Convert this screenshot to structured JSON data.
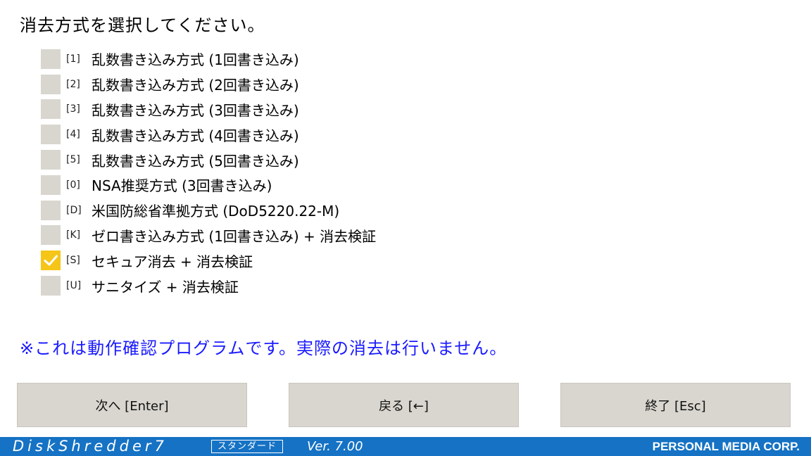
{
  "prompt": "消去方式を選択してください。",
  "options": [
    {
      "key": "[1]",
      "label": "乱数書き込み方式 (1回書き込み)",
      "checked": false
    },
    {
      "key": "[2]",
      "label": "乱数書き込み方式 (2回書き込み)",
      "checked": false
    },
    {
      "key": "[3]",
      "label": "乱数書き込み方式 (3回書き込み)",
      "checked": false
    },
    {
      "key": "[4]",
      "label": "乱数書き込み方式 (4回書き込み)",
      "checked": false
    },
    {
      "key": "[5]",
      "label": "乱数書き込み方式 (5回書き込み)",
      "checked": false
    },
    {
      "key": "[0]",
      "label": "NSA推奨方式 (3回書き込み)",
      "checked": false
    },
    {
      "key": "[D]",
      "label": "米国防総省準拠方式 (DoD5220.22-M)",
      "checked": false
    },
    {
      "key": "[K]",
      "label": "ゼロ書き込み方式 (1回書き込み) + 消去検証",
      "checked": false
    },
    {
      "key": "[S]",
      "label": "セキュア消去 + 消去検証",
      "checked": true
    },
    {
      "key": "[U]",
      "label": "サニタイズ + 消去検証",
      "checked": false
    }
  ],
  "notice": "※これは動作確認プログラムです。実際の消去は行いません。",
  "buttons": {
    "next": "次へ [Enter]",
    "back": "戻る [←]",
    "exit": "終了 [Esc]"
  },
  "footer": {
    "brand": "DiskShredder7",
    "edition": "スタンダード",
    "version": "Ver. 7.00",
    "company": "PERSONAL MEDIA CORP."
  },
  "colors": {
    "accent": "#1572c4",
    "notice": "#1a1aff",
    "checked": "#f5c518",
    "button": "#d8d6ce"
  }
}
